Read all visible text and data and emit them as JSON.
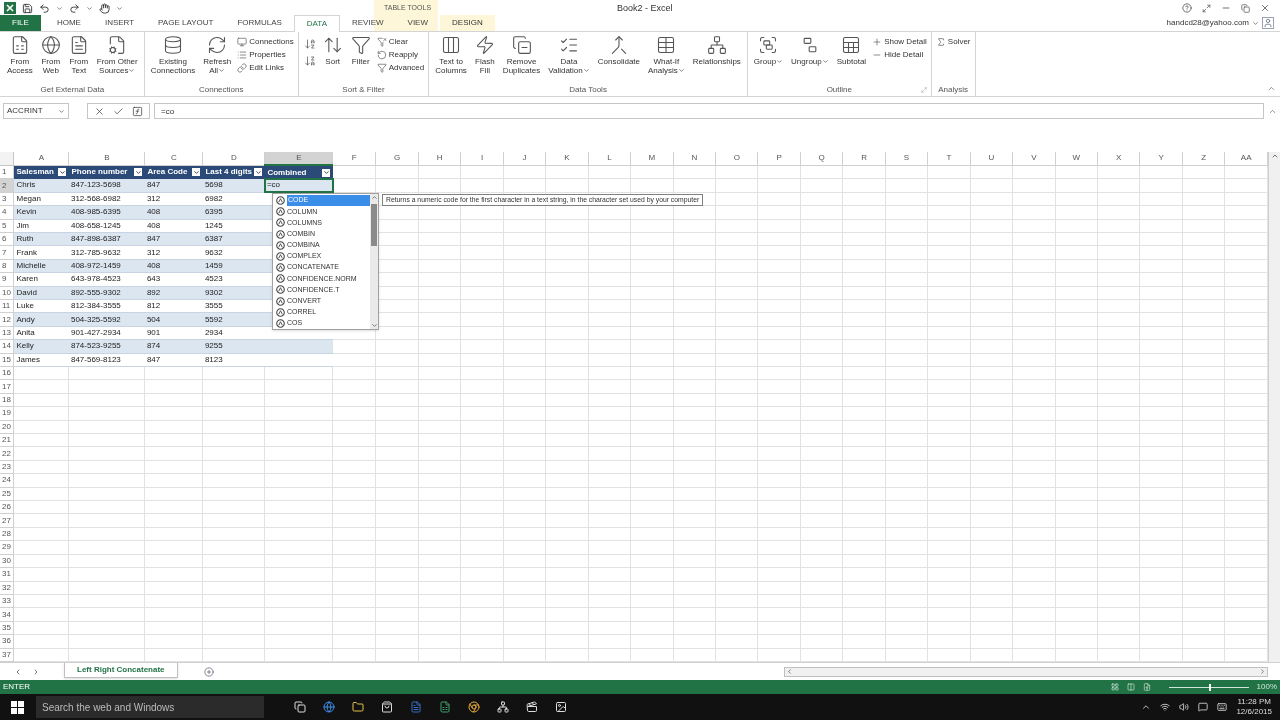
{
  "title_bar": {
    "title": "Book2 - Excel",
    "context_label": "TABLE TOOLS",
    "account": "handcd28@yahoo.com"
  },
  "tabs": [
    {
      "label": "FILE",
      "kind": "file",
      "selected": false
    },
    {
      "label": "HOME",
      "kind": "normal",
      "selected": false
    },
    {
      "label": "INSERT",
      "kind": "normal",
      "selected": false
    },
    {
      "label": "PAGE LAYOUT",
      "kind": "normal",
      "selected": false
    },
    {
      "label": "FORMULAS",
      "kind": "normal",
      "selected": false
    },
    {
      "label": "DATA",
      "kind": "normal",
      "selected": true
    },
    {
      "label": "REVIEW",
      "kind": "normal",
      "selected": false
    },
    {
      "label": "VIEW",
      "kind": "normal",
      "selected": false
    },
    {
      "label": "DESIGN",
      "kind": "contextual",
      "selected": false
    }
  ],
  "ribbon": [
    {
      "label": "Get External Data",
      "launcher": false,
      "buttons": [
        {
          "kind": "large",
          "label": "From\nAccess",
          "menu": false
        },
        {
          "kind": "large",
          "label": "From\nWeb",
          "menu": false
        },
        {
          "kind": "large",
          "label": "From\nText",
          "menu": false
        },
        {
          "kind": "large",
          "label": "From Other\nSources",
          "menu": true
        }
      ]
    },
    {
      "label": "Connections",
      "launcher": false,
      "buttons": [
        {
          "kind": "large",
          "label": "Existing\nConnections",
          "menu": false
        },
        {
          "kind": "large",
          "label": "Refresh\nAll",
          "menu": true
        },
        {
          "kind": "small",
          "label": "Connections",
          "menu": false
        },
        {
          "kind": "small",
          "label": "Properties",
          "menu": false
        },
        {
          "kind": "small",
          "label": "Edit Links",
          "menu": false
        }
      ]
    },
    {
      "label": "Sort & Filter",
      "launcher": false,
      "buttons": [
        {
          "kind": "icon"
        },
        {
          "kind": "icon"
        },
        {
          "kind": "large",
          "label": "Sort",
          "menu": false
        },
        {
          "kind": "large",
          "label": "Filter",
          "menu": false
        },
        {
          "kind": "small",
          "label": "Clear",
          "menu": false
        },
        {
          "kind": "small",
          "label": "Reapply",
          "menu": false
        },
        {
          "kind": "small",
          "label": "Advanced",
          "menu": false
        }
      ]
    },
    {
      "label": "Data Tools",
      "launcher": false,
      "buttons": [
        {
          "kind": "large",
          "label": "Text to\nColumns",
          "menu": false
        },
        {
          "kind": "large",
          "label": "Flash\nFill",
          "menu": false
        },
        {
          "kind": "large",
          "label": "Remove\nDuplicates",
          "menu": false
        },
        {
          "kind": "large",
          "label": "Data\nValidation",
          "menu": true
        },
        {
          "kind": "large",
          "label": "Consolidate",
          "menu": false
        },
        {
          "kind": "large",
          "label": "What-If\nAnalysis",
          "menu": true
        },
        {
          "kind": "large",
          "label": "Relationships",
          "menu": false
        }
      ]
    },
    {
      "label": "Outline",
      "launcher": true,
      "buttons": [
        {
          "kind": "large",
          "label": "Group",
          "menu": true
        },
        {
          "kind": "large",
          "label": "Ungroup",
          "menu": true
        },
        {
          "kind": "large",
          "label": "Subtotal",
          "menu": false
        },
        {
          "kind": "small",
          "label": "Show Detail",
          "menu": false
        },
        {
          "kind": "small",
          "label": "Hide Detail",
          "menu": false
        }
      ]
    },
    {
      "label": "Analysis",
      "launcher": false,
      "buttons": [
        {
          "kind": "small",
          "label": "Solver",
          "menu": false
        }
      ]
    }
  ],
  "formula_bar": {
    "name_box": "ACCRINT",
    "formula": "=co"
  },
  "columns": [
    {
      "label": "A",
      "selected": false
    },
    {
      "label": "B",
      "selected": false
    },
    {
      "label": "C",
      "selected": false
    },
    {
      "label": "D",
      "selected": false
    },
    {
      "label": "E",
      "selected": true
    },
    {
      "label": "F",
      "selected": false
    },
    {
      "label": "G",
      "selected": false
    },
    {
      "label": "H",
      "selected": false
    },
    {
      "label": "I",
      "selected": false
    },
    {
      "label": "J",
      "selected": false
    },
    {
      "label": "K",
      "selected": false
    },
    {
      "label": "L",
      "selected": false
    },
    {
      "label": "M",
      "selected": false
    },
    {
      "label": "N",
      "selected": false
    },
    {
      "label": "O",
      "selected": false
    },
    {
      "label": "P",
      "selected": false
    },
    {
      "label": "Q",
      "selected": false
    },
    {
      "label": "R",
      "selected": false
    },
    {
      "label": "S",
      "selected": false
    },
    {
      "label": "T",
      "selected": false
    },
    {
      "label": "U",
      "selected": false
    },
    {
      "label": "V",
      "selected": false
    },
    {
      "label": "W",
      "selected": false
    },
    {
      "label": "X",
      "selected": false
    },
    {
      "label": "Y",
      "selected": false
    },
    {
      "label": "Z",
      "selected": false
    },
    {
      "label": "AA",
      "selected": false
    }
  ],
  "rows": [
    {
      "label": "1",
      "selected": false
    },
    {
      "label": "2",
      "selected": true
    },
    {
      "label": "3",
      "selected": false
    },
    {
      "label": "4",
      "selected": false
    },
    {
      "label": "5",
      "selected": false
    },
    {
      "label": "6",
      "selected": false
    },
    {
      "label": "7",
      "selected": false
    },
    {
      "label": "8",
      "selected": false
    },
    {
      "label": "9",
      "selected": false
    },
    {
      "label": "10",
      "selected": false
    },
    {
      "label": "11",
      "selected": false
    },
    {
      "label": "12",
      "selected": false
    },
    {
      "label": "13",
      "selected": false
    },
    {
      "label": "14",
      "selected": false
    },
    {
      "label": "15",
      "selected": false
    },
    {
      "label": "16",
      "selected": false
    },
    {
      "label": "17",
      "selected": false
    },
    {
      "label": "18",
      "selected": false
    },
    {
      "label": "19",
      "selected": false
    },
    {
      "label": "20",
      "selected": false
    },
    {
      "label": "21",
      "selected": false
    },
    {
      "label": "22",
      "selected": false
    },
    {
      "label": "23",
      "selected": false
    },
    {
      "label": "24",
      "selected": false
    },
    {
      "label": "25",
      "selected": false
    },
    {
      "label": "26",
      "selected": false
    },
    {
      "label": "27",
      "selected": false
    },
    {
      "label": "28",
      "selected": false
    },
    {
      "label": "29",
      "selected": false
    },
    {
      "label": "30",
      "selected": false
    },
    {
      "label": "31",
      "selected": false
    },
    {
      "label": "32",
      "selected": false
    },
    {
      "label": "33",
      "selected": false
    },
    {
      "label": "34",
      "selected": false
    },
    {
      "label": "35",
      "selected": false
    },
    {
      "label": "36",
      "selected": false
    },
    {
      "label": "37",
      "selected": false
    }
  ],
  "table": {
    "columns": [
      "Salesman",
      "Phone number",
      "Area Code",
      "Last 4 digits",
      "Combined"
    ],
    "rows": [
      {
        "cells": [
          "Chris",
          "847-123-5698",
          "847",
          "5698",
          "=co"
        ]
      },
      {
        "cells": [
          "Megan",
          "312-568-6982",
          "312",
          "6982"
        ]
      },
      {
        "cells": [
          "Kevin",
          "408-985-6395",
          "408",
          "6395"
        ]
      },
      {
        "cells": [
          "Jim",
          "408-658-1245",
          "408",
          "1245"
        ]
      },
      {
        "cells": [
          "Ruth",
          "847-898-6387",
          "847",
          "6387"
        ]
      },
      {
        "cells": [
          "Frank",
          "312-785-9632",
          "312",
          "9632"
        ]
      },
      {
        "cells": [
          "Michelle",
          "408-972-1459",
          "408",
          "1459"
        ]
      },
      {
        "cells": [
          "Karen",
          "643-978-4523",
          "643",
          "4523"
        ]
      },
      {
        "cells": [
          "David",
          "892-555-9302",
          "892",
          "9302"
        ]
      },
      {
        "cells": [
          "Luke",
          "812-384-3555",
          "812",
          "3555"
        ]
      },
      {
        "cells": [
          "Andy",
          "504-325-5592",
          "504",
          "5592"
        ]
      },
      {
        "cells": [
          "Anita",
          "901-427-2934",
          "901",
          "2934"
        ]
      },
      {
        "cells": [
          "Kelly",
          "874-523-9255",
          "874",
          "9255"
        ]
      },
      {
        "cells": [
          "James",
          "847-569-8123",
          "847",
          "8123"
        ]
      }
    ]
  },
  "autocomplete": {
    "items": [
      {
        "label": "CODE",
        "selected": true
      },
      {
        "label": "COLUMN",
        "selected": false
      },
      {
        "label": "COLUMNS",
        "selected": false
      },
      {
        "label": "COMBIN",
        "selected": false
      },
      {
        "label": "COMBINA",
        "selected": false
      },
      {
        "label": "COMPLEX",
        "selected": false
      },
      {
        "label": "CONCATENATE",
        "selected": false
      },
      {
        "label": "CONFIDENCE.NORM",
        "selected": false
      },
      {
        "label": "CONFIDENCE.T",
        "selected": false
      },
      {
        "label": "CONVERT",
        "selected": false
      },
      {
        "label": "CORREL",
        "selected": false
      },
      {
        "label": "COS",
        "selected": false
      }
    ],
    "tooltip": "Returns a numeric code for the first character in a text string, in the character set used by your computer"
  },
  "sheet_tabs": [
    {
      "label": "Left Right Concatenate",
      "selected": true
    }
  ],
  "status_bar": {
    "mode": "ENTER",
    "zoom": "100%",
    "zoom_slider": {
      "level": 0.5
    }
  },
  "taskbar": {
    "search_placeholder": "Search the web and Windows",
    "time": "11:28 PM",
    "date": "12/6/2015"
  }
}
